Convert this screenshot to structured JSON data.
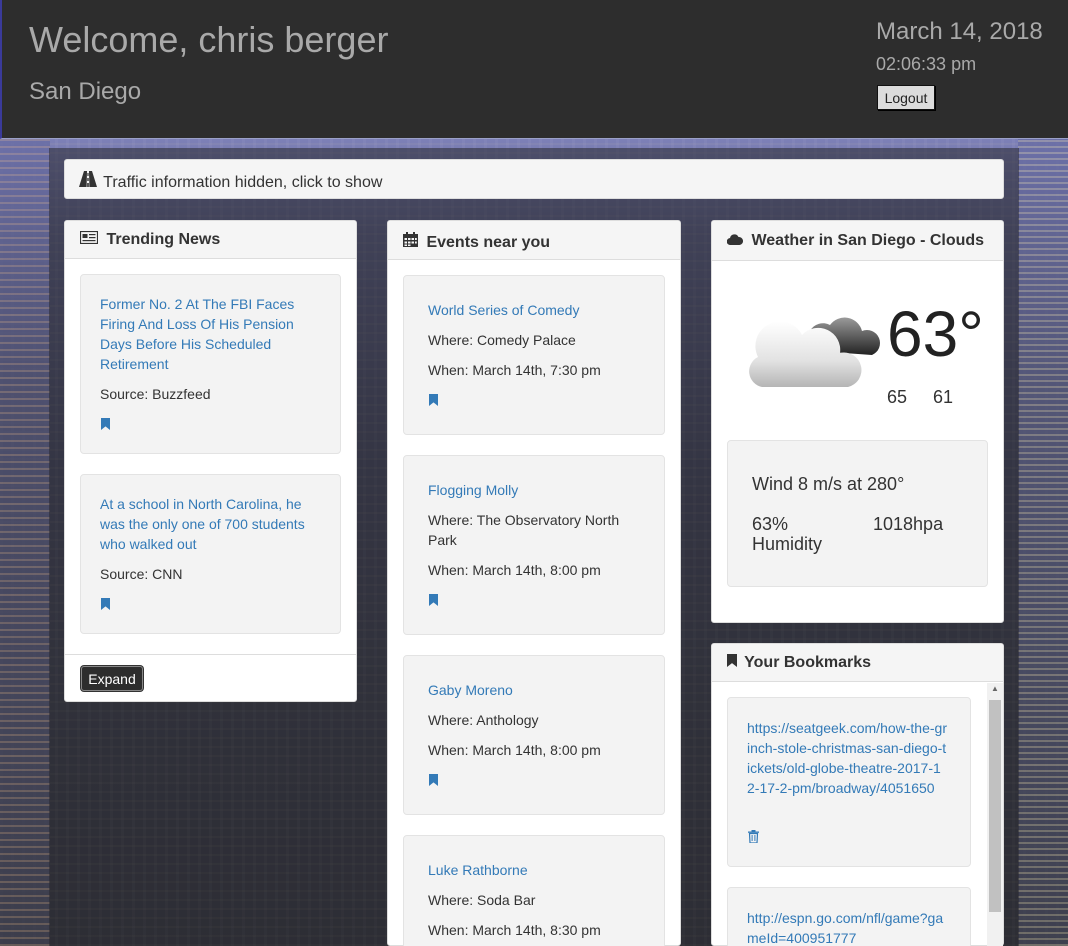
{
  "header": {
    "welcome": "Welcome, chris berger",
    "city": "San Diego",
    "date": "March 14, 2018",
    "time": "02:06:33 pm",
    "logout_label": "Logout"
  },
  "traffic": {
    "icon": "road-icon",
    "text": "Traffic information hidden, click to show"
  },
  "news": {
    "title": "Trending News",
    "icon": "newspaper-icon",
    "items": [
      {
        "headline": "Former No. 2 At The FBI Faces Firing And Loss Of His Pension Days Before His Scheduled Retirement",
        "source": "Source: Buzzfeed"
      },
      {
        "headline": "At a school in North Carolina, he was the only one of 700 students who walked out",
        "source": "Source: CNN"
      }
    ],
    "expand_label": "Expand"
  },
  "events": {
    "title": "Events near you",
    "icon": "calendar-icon",
    "items": [
      {
        "name": "World Series of Comedy",
        "where": "Where: Comedy Palace",
        "when": "When: March 14th, 7:30 pm"
      },
      {
        "name": "Flogging Molly",
        "where": "Where: The Observatory North Park",
        "when": "When: March 14th, 8:00 pm"
      },
      {
        "name": "Gaby Moreno",
        "where": "Where: Anthology",
        "when": "When: March 14th, 8:00 pm"
      },
      {
        "name": "Luke Rathborne",
        "where": "Where: Soda Bar",
        "when": "When: March 14th, 8:30 pm"
      }
    ]
  },
  "weather": {
    "title": "Weather in San Diego - Clouds",
    "icon": "cloud-icon",
    "temp": "63°",
    "high": "65",
    "low": "61",
    "wind": "Wind 8 m/s at 280°",
    "humidity": "63% Humidity",
    "pressure": "1018hpa"
  },
  "bookmarks": {
    "title": "Your Bookmarks",
    "icon": "bookmark-icon",
    "items": [
      {
        "url": "https://seatgeek.com/how-the-grinch-stole-christmas-san-diego-tickets/old-globe-theatre-2017-12-17-2-pm/broadway/4051650"
      },
      {
        "url": "http://espn.go.com/nfl/game?gameId=400951777"
      }
    ]
  },
  "colors": {
    "link": "#337ab7",
    "header_bg": "#2d2d2d",
    "header_text": "#a9a9a9"
  }
}
